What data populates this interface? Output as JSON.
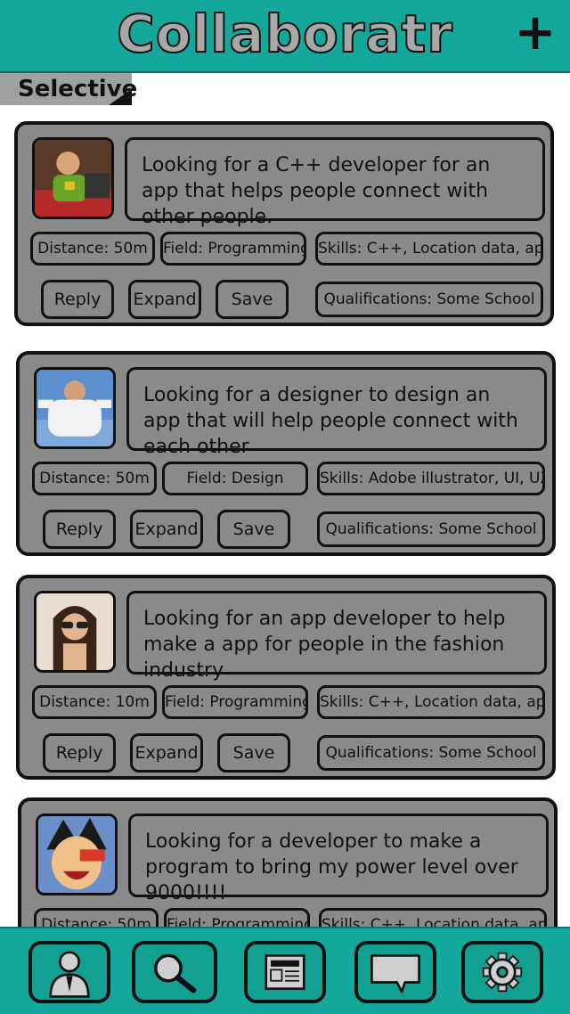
{
  "header": {
    "title": "Collaboratr",
    "add_label": "+"
  },
  "filter": {
    "label": "Selective"
  },
  "posts": [
    {
      "description": "Looking for a C++ developer for an app that helps people connect with other people.",
      "distance": "Distance: 50m",
      "field": "Field: Programming",
      "skills": "Skills: C++, Location data, app",
      "qualifications": "Qualifications: Some School",
      "reply": "Reply",
      "expand": "Expand",
      "save": "Save"
    },
    {
      "description": "Looking for a designer to design an app that will help people connect with each other",
      "distance": "Distance: 50m",
      "field": "Field: Design",
      "skills": "Skills: Adobe illustrator, UI, UX",
      "qualifications": "Qualifications: Some School",
      "reply": "Reply",
      "expand": "Expand",
      "save": "Save"
    },
    {
      "description": "Looking for an app developer to help make a app for people in the fashion industry",
      "distance": "Distance: 10m",
      "field": "Field: Programming",
      "skills": "Skills: C++, Location data, app",
      "qualifications": "Qualifications: Some School",
      "reply": "Reply",
      "expand": "Expand",
      "save": "Save"
    },
    {
      "description": "Looking for a developer to make a program to bring my power level over 9000!!!!",
      "distance": "Distance: 50m",
      "field": "Field: Programming",
      "skills": "Skills: C++, Location data, app"
    }
  ],
  "nav": [
    {
      "icon": "profile-icon"
    },
    {
      "icon": "search-icon"
    },
    {
      "icon": "newspaper-icon"
    },
    {
      "icon": "chat-icon"
    },
    {
      "icon": "gear-icon"
    }
  ],
  "colors": {
    "accent": "#14a89c",
    "card": "#8a8a8a",
    "outline": "#111111"
  }
}
